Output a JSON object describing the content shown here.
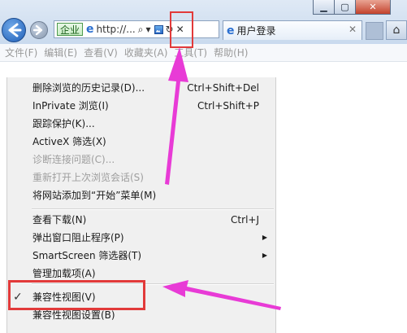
{
  "window": {
    "minimize_icon": "minimize-icon",
    "maximize_icon": "maximize-icon",
    "close_icon": "close-icon"
  },
  "nav": {
    "back_icon": "back-arrow-icon",
    "forward_icon": "forward-arrow-icon"
  },
  "address": {
    "site_badge": "企业",
    "url_text": "http://...",
    "search_glyph": "⌕",
    "dropdown_glyph": "▾",
    "refresh_glyph": "↻",
    "stop_glyph": "✕"
  },
  "tab": {
    "title": "用户登录",
    "close_glyph": "✕"
  },
  "home": {
    "glyph": "⌂"
  },
  "menubar": {
    "items": [
      {
        "label": "文件(F)"
      },
      {
        "label": "编辑(E)"
      },
      {
        "label": "查看(V)"
      },
      {
        "label": "收藏夹(A)"
      },
      {
        "label": "工具(T)"
      },
      {
        "label": "帮助(H)"
      }
    ]
  },
  "tools_menu": {
    "items": [
      {
        "label": "删除浏览的历史记录(D)...",
        "shortcut": "Ctrl+Shift+Del"
      },
      {
        "label": "InPrivate 浏览(I)",
        "shortcut": "Ctrl+Shift+P"
      },
      {
        "label": "跟踪保护(K)...",
        "shortcut": ""
      },
      {
        "label": "ActiveX 筛选(X)",
        "shortcut": ""
      },
      {
        "label": "诊断连接问题(C)...",
        "shortcut": "",
        "disabled": true
      },
      {
        "label": "重新打开上次浏览会话(S)",
        "shortcut": "",
        "disabled": true
      },
      {
        "label": "将网站添加到“开始”菜单(M)",
        "shortcut": ""
      },
      {
        "label": "查看下载(N)",
        "shortcut": "Ctrl+J"
      },
      {
        "label": "弹出窗口阻止程序(P)",
        "submenu_glyph": "▶"
      },
      {
        "label": "SmartScreen 筛选器(T)",
        "submenu_glyph": "▶"
      },
      {
        "label": "管理加载项(A)",
        "shortcut": ""
      },
      {
        "label": "兼容性视图(V)",
        "checked": true,
        "check_glyph": "✓"
      },
      {
        "label": "兼容性视图设置(B)",
        "shortcut": ""
      }
    ]
  },
  "colors": {
    "annotation_box": "#e23a3a",
    "annotation_arrow": "#e83bd6"
  }
}
